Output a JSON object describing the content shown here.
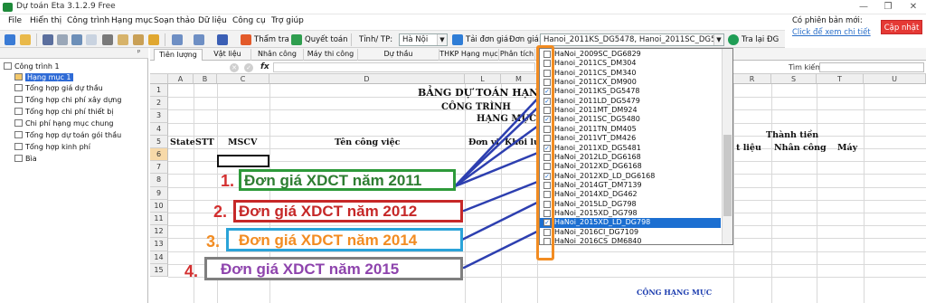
{
  "app": {
    "title": "Dự toán Eta 3.1.2.9 Free"
  },
  "menu": [
    "File",
    "Hiển thị",
    "Công trình",
    "Hạng mục",
    "Soạn thảo",
    "Dữ liệu",
    "Công cụ",
    "Trợ giúp"
  ],
  "update": {
    "line1": "Có phiên bản mới:",
    "line2": "Click để xem chi tiết",
    "button": "Cập nhật"
  },
  "toolbar": {
    "review": "Thẩm tra",
    "settlement": "Quyết toán",
    "province_label": "Tỉnh/ TP:",
    "province_value": "Hà Nội",
    "load_price": "Tải đơn giá",
    "price_label": "Đơn giá:",
    "price_value": "Hanoi_2011KS_DG5478, Hanoi_2011SC_DG5480, HaNoi",
    "back": "Tra lại ĐG"
  },
  "tree": {
    "pin": "ᵖ",
    "root": "Công trình 1",
    "items": [
      "Hạng mục 1",
      "Tổng hợp giá dự thầu",
      "Tổng hợp chi phí xây dựng",
      "Tổng hợp chi phí thiết bị",
      "Chi phí hạng mục chung",
      "Tổng hợp dự toán gói thầu",
      "Tổng hợp kinh phí",
      "Bìa"
    ]
  },
  "tabs": [
    "Tiên lượng",
    "Vật liệu",
    "Nhân công",
    "Máy thi công",
    "Dự thầu",
    "THKP Hạng mục",
    "Phân tích"
  ],
  "formula": {
    "fx": "fx",
    "search_label": "Tìm kiếm",
    "search_value": ""
  },
  "columns": [
    "A",
    "B",
    "C",
    "D",
    "L",
    "M",
    "R",
    "S",
    "T",
    "U"
  ],
  "rows": [
    "1",
    "2",
    "3",
    "4",
    "5",
    "6",
    "7",
    "8",
    "9",
    "10",
    "11",
    "12",
    "13",
    "14",
    "15"
  ],
  "sheet": {
    "title": "BẢNG DỰ TOÁN HẠNG",
    "project": "CÔNG TRÌNH",
    "item": "HẠNG MỤC",
    "state": "State",
    "stt": "STT",
    "mscv": "MSCV",
    "work_name": "Tên công việc",
    "unit": "Đơn vị",
    "volume": "Khối lượ",
    "thanh_tien": "Thành tiền",
    "vat_lieu": "t liệu",
    "nhan_cong": "Nhân công",
    "may": "Máy",
    "total": "CỘNG HẠNG MỤC"
  },
  "dropdown": {
    "items": [
      "HaNoi_2009SC_DG6829",
      "Hanoi_2011CS_DM304",
      "Hanoi_2011CS_DM340",
      "Hanoi_2011CX_DM900",
      "Hanoi_2011KS_DG5478",
      "Hanoi_2011LD_DG5479",
      "Hanoi_2011MT_DM924",
      "Hanoi_2011SC_DG5480",
      "Hanoi_2011TN_DM405",
      "Hanoi_2011VT_DM426",
      "Hanoi_2011XD_DG5481",
      "HaNoi_2012LD_DG6168",
      "HaNoi_2012XD_DG6168",
      "HaNoi_2012XD_LD_DG6168",
      "HaNoi_2014GT_DM7139",
      "HaNoi_2014XD_DG462",
      "HaNoi_2015LD_DG798",
      "HaNoi_2015XD_DG798",
      "HaNoi_2015XD_LD_DG798",
      "HaNoi_2016CI_DG7109",
      "HaNoi_2016CS_DM6840"
    ],
    "checked": [
      false,
      false,
      false,
      false,
      true,
      true,
      false,
      true,
      false,
      false,
      true,
      false,
      false,
      true,
      false,
      false,
      false,
      false,
      true,
      false,
      false
    ],
    "highlighted_index": 18
  },
  "annotations": [
    {
      "number": "1.",
      "text": "Đơn giá XDCT năm 2011",
      "color": "#d32f2f",
      "text_color": "#2e7d32",
      "box_color": "#2e9a3a"
    },
    {
      "number": "2.",
      "text": "Đơn giá XDCT năm 2012",
      "color": "#d32f2f",
      "text_color": "#c62828",
      "box_color": "#c62828"
    },
    {
      "number": "3.",
      "text": "Đơn giá XDCT năm 2014",
      "color": "#f28c22",
      "text_color": "#f28c22",
      "box_color": "#2aa3d8"
    },
    {
      "number": "4.",
      "text": "Đơn giá XDCT năm 2015",
      "color": "#d32f2f",
      "text_color": "#8e44ad",
      "box_color": "#7f7f7f"
    }
  ],
  "colors": {
    "highlight": "#f28c22",
    "arrow": "#2d3fb0",
    "accent_blue": "#1c6fd1"
  }
}
